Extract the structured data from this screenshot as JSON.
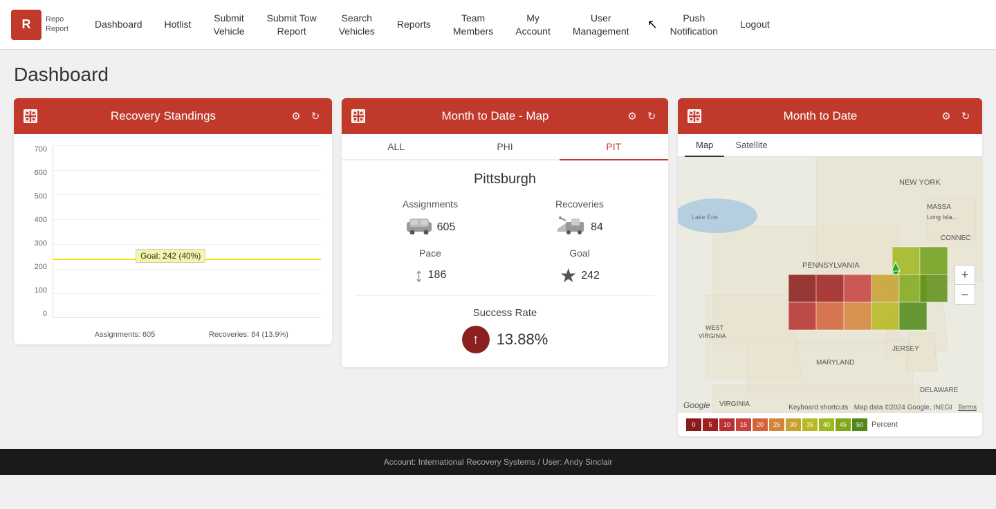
{
  "app": {
    "logo_text": "R",
    "logo_subtext": "Repo\nReport"
  },
  "nav": {
    "items": [
      {
        "label": "Dashboard",
        "id": "dashboard"
      },
      {
        "label": "Hotlist",
        "id": "hotlist"
      },
      {
        "label": "Submit\nVehicle",
        "id": "submit-vehicle"
      },
      {
        "label": "Submit Tow\nReport",
        "id": "submit-tow"
      },
      {
        "label": "Search\nVehicles",
        "id": "search-vehicles"
      },
      {
        "label": "Reports",
        "id": "reports"
      },
      {
        "label": "Team\nMembers",
        "id": "team-members"
      },
      {
        "label": "My\nAccount",
        "id": "my-account"
      },
      {
        "label": "User\nManagement",
        "id": "user-management"
      },
      {
        "label": "Push\nNotification",
        "id": "push-notification"
      },
      {
        "label": "Logout",
        "id": "logout"
      }
    ]
  },
  "page": {
    "title": "Dashboard"
  },
  "widget_recovery": {
    "title": "Recovery Standings",
    "goal_label": "Goal: 242 (40%)",
    "bar1_label": "Assignments: 605",
    "bar2_label": "Recoveries: 84 (13.9%)",
    "y_labels": [
      "700",
      "600",
      "500",
      "400",
      "300",
      "200",
      "100",
      "0"
    ],
    "bar1_value": 605,
    "bar2_value": 84,
    "max_value": 700
  },
  "widget_map_chart": {
    "title": "Month to Date - Map",
    "tabs": [
      {
        "label": "ALL",
        "id": "all",
        "active": false
      },
      {
        "label": "PHI",
        "id": "phi",
        "active": false
      },
      {
        "label": "PIT",
        "id": "pit",
        "active": true
      }
    ],
    "city": "Pittsburgh",
    "assignments_label": "Assignments",
    "recoveries_label": "Recoveries",
    "assignments_value": "605",
    "recoveries_value": "84",
    "pace_label": "Pace",
    "goal_label": "Goal",
    "pace_value": "186",
    "goal_value": "242",
    "success_rate_label": "Success Rate",
    "success_rate_value": "13.88%"
  },
  "widget_month_to_date": {
    "title": "Month to Date",
    "map_tabs": [
      {
        "label": "Map",
        "active": true
      },
      {
        "label": "Satellite",
        "active": false
      }
    ],
    "attribution": "Map data ©2024 Google, INEGI",
    "terms": "Terms",
    "keyboard": "Keyboard shortcuts",
    "legend_values": [
      "0",
      "5",
      "10",
      "15",
      "20",
      "25",
      "30",
      "35",
      "40",
      "45",
      "50"
    ],
    "legend_colors": [
      "#8b1a1a",
      "#a02020",
      "#b83030",
      "#c84040",
      "#d4623a",
      "#d4843a",
      "#c8a030",
      "#b8b820",
      "#a0b820",
      "#80a818",
      "#508818"
    ],
    "legend_label": "Percent"
  },
  "footer": {
    "text": "Account: International Recovery Systems / User: Andy Sinclair"
  }
}
